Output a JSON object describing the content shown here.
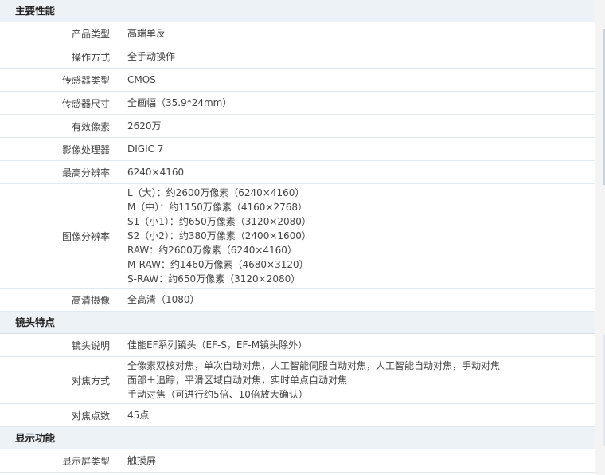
{
  "sections": [
    {
      "title": "主要性能",
      "rows": [
        {
          "label": "产品类型",
          "lines": [
            "高端单反"
          ]
        },
        {
          "label": "操作方式",
          "lines": [
            "全手动操作"
          ]
        },
        {
          "label": "传感器类型",
          "lines": [
            "CMOS"
          ]
        },
        {
          "label": "传感器尺寸",
          "lines": [
            "全画幅（35.9*24mm）"
          ]
        },
        {
          "label": "有效像素",
          "lines": [
            "2620万"
          ]
        },
        {
          "label": "影像处理器",
          "lines": [
            "DIGIC 7"
          ]
        },
        {
          "label": "最高分辨率",
          "lines": [
            "6240×4160"
          ]
        },
        {
          "label": "图像分辨率",
          "lines": [
            "L（大）：约2600万像素（6240×4160）",
            "M（中）：约1150万像素（4160×2768）",
            "S1（小1）：约650万像素（3120×2080）",
            "S2（小2）：约380万像素（2400×1600）",
            "RAW：约2600万像素（6240×4160）",
            "M-RAW：约1460万像素（4680×3120）",
            "S-RAW：约650万像素（3120×2080）"
          ]
        },
        {
          "label": "高清摄像",
          "lines": [
            "全高清（1080）"
          ]
        }
      ]
    },
    {
      "title": "镜头特点",
      "rows": [
        {
          "label": "镜头说明",
          "lines": [
            "佳能EF系列镜头（EF-S，EF-M镜头除外）"
          ]
        },
        {
          "label": "对焦方式",
          "lines": [
            "全像素双核对焦，单次自动对焦，人工智能伺服自动对焦，人工智能自动对焦，手动对焦",
            "面部＋追踪，平滑区域自动对焦，实时单点自动对焦",
            "手动对焦（可进行约5倍、10倍放大确认）"
          ]
        },
        {
          "label": "对焦点数",
          "lines": [
            "45点"
          ]
        }
      ]
    },
    {
      "title": "显示功能",
      "rows": [
        {
          "label": "显示屏类型",
          "lines": [
            "触摸屏"
          ]
        }
      ]
    }
  ]
}
